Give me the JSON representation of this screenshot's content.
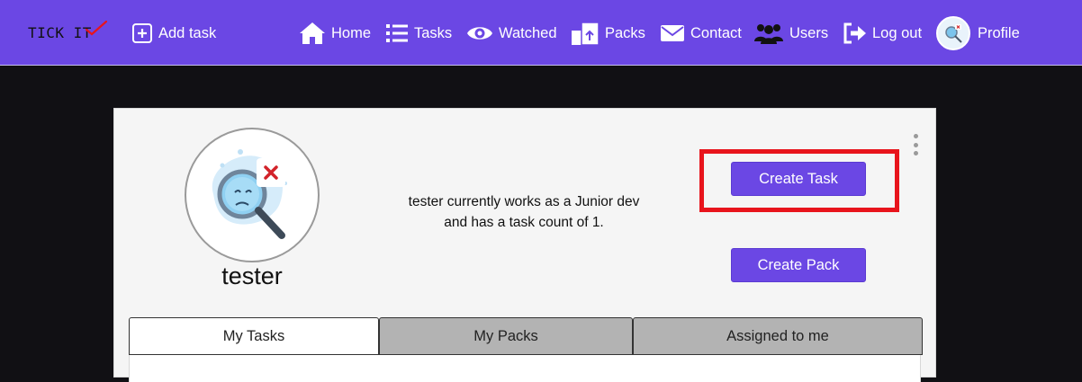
{
  "navbar": {
    "brand": "TICK IT",
    "add_task": "Add task",
    "items": [
      {
        "label": "Home",
        "icon": "home-icon"
      },
      {
        "label": "Tasks",
        "icon": "list-icon"
      },
      {
        "label": "Watched",
        "icon": "eye-icon"
      },
      {
        "label": "Packs",
        "icon": "boxes-icon"
      },
      {
        "label": "Contact",
        "icon": "envelope-icon"
      },
      {
        "label": "Users",
        "icon": "users-icon"
      },
      {
        "label": "Log out",
        "icon": "logout-icon"
      }
    ],
    "profile": "Profile"
  },
  "profile": {
    "username": "tester",
    "bio_line1": "tester currently works as a Junior dev",
    "bio_line2": "and has a task count of 1.",
    "create_task": "Create Task",
    "create_pack": "Create Pack"
  },
  "tabs": [
    {
      "label": "My Tasks",
      "active": true
    },
    {
      "label": "My Packs",
      "active": false
    },
    {
      "label": "Assigned to me",
      "active": false
    }
  ],
  "colors": {
    "navbar": "#6b47e4",
    "button": "#6b47e4",
    "highlight": "#e8141c",
    "background": "#111014"
  }
}
